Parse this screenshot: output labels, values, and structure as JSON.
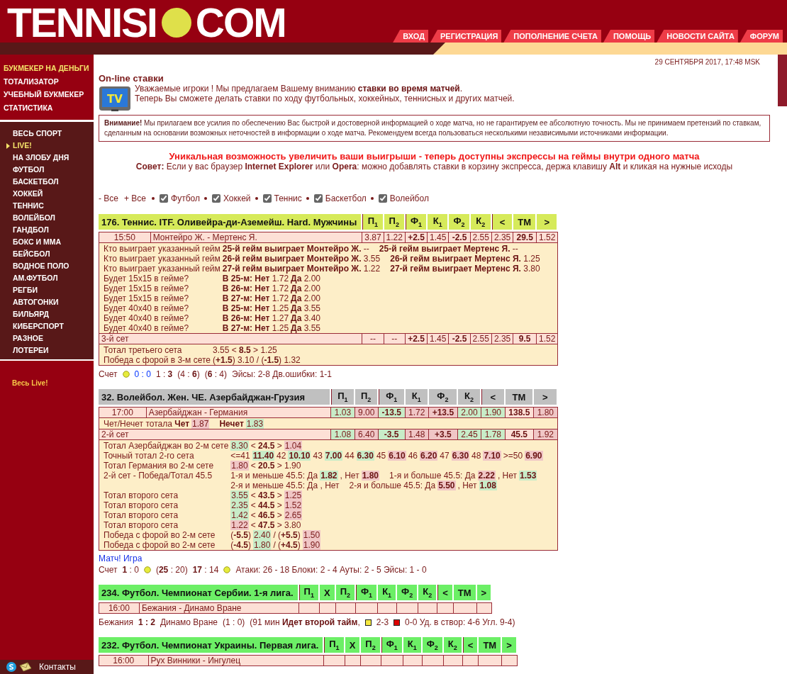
{
  "logo": {
    "left": "TENNISI",
    "right": "COM"
  },
  "nav": [
    {
      "label": "ВХОД"
    },
    {
      "label": "РЕГИСТРАЦИЯ"
    },
    {
      "label": "ПОПОЛНЕНИЕ СЧЕТА"
    },
    {
      "label": "ПОМОЩЬ"
    },
    {
      "label": "НОВОСТИ САЙТА"
    },
    {
      "label": "ФОРУМ"
    }
  ],
  "sidebar": {
    "main": [
      {
        "label": "БУКМЕКЕР НА ДЕНЬГИ",
        "selected": true
      },
      {
        "label": "ТОТАЛИЗАТОР",
        "selected": false
      },
      {
        "label": "УЧЕБНЫЙ БУКМЕКЕР",
        "selected": false
      },
      {
        "label": "СТАТИСТИКА",
        "selected": false
      }
    ],
    "sports": [
      {
        "label": "ВЕСЬ СПОРТ",
        "selected": false
      },
      {
        "label": "LIVE!",
        "selected": true
      },
      {
        "label": "НА ЗЛОБУ ДНЯ",
        "selected": false
      },
      {
        "label": "ФУТБОЛ",
        "selected": false
      },
      {
        "label": "БАСКЕТБОЛ",
        "selected": false
      },
      {
        "label": "ХОККЕЙ",
        "selected": false
      },
      {
        "label": "ТЕННИС",
        "selected": false
      },
      {
        "label": "ВОЛЕЙБОЛ",
        "selected": false
      },
      {
        "label": "ГАНДБОЛ",
        "selected": false
      },
      {
        "label": "БОКС И ММА",
        "selected": false
      },
      {
        "label": "БЕЙСБОЛ",
        "selected": false
      },
      {
        "label": "ВОДНОЕ ПОЛО",
        "selected": false
      },
      {
        "label": "АМ.ФУТБОЛ",
        "selected": false
      },
      {
        "label": "РЕГБИ",
        "selected": false
      },
      {
        "label": "АВТОГОНКИ",
        "selected": false
      },
      {
        "label": "БИЛЬЯРД",
        "selected": false
      },
      {
        "label": "КИБЕРСПОРТ",
        "selected": false
      },
      {
        "label": "РАЗНОЕ",
        "selected": false
      },
      {
        "label": "ЛОТЕРЕИ",
        "selected": false
      }
    ],
    "live_link": "Весь Live!",
    "contacts": "Контакты"
  },
  "date": "29 СЕНТЯБРЯ 2017, 17:48 MSK",
  "intro": {
    "title": "On-line ставки",
    "icon_label": "TV",
    "lines": [
      "Уважаемые игроки ! Мы предлагаем Вашему вниманию **ставки во время матчей**.",
      "Теперь Вы сможете делать ставки по ходу футбольных, хоккейных, теннисных и других матчей."
    ]
  },
  "notice": "**Внимание!** Мы прилагаем все усилия по обеспечению Вас быстрой и достоверной информацией о ходе матча, но не гарантируем ее абсолютную точность. Мы не принимаем претензий по ставкам, сделанным на основании возможных неточностей в информации о ходе матча. Рекомендуем всегда пользоваться несколькими независимыми источниками информации.",
  "promo": "Уникальная возможность увеличить ваши выигрыши - теперь доступны экспрессы на геймы внутри одного матча",
  "tip": "**Совет:** Если у вас браузер **Internet Explorer** или **Opera**: можно добавлять ставки в корзину экспресса, держа клавишу **Alt** и кликая на нужные исходы",
  "filters": {
    "minus_all": "- Все",
    "plus_all": "+ Все",
    "sports": [
      {
        "label": "Футбол",
        "checked": true
      },
      {
        "label": "Хоккей",
        "checked": true
      },
      {
        "label": "Теннис",
        "checked": true
      },
      {
        "label": "Баскетбол",
        "checked": true
      },
      {
        "label": "Волейбол",
        "checked": true
      }
    ]
  },
  "events": [
    {
      "title": "176. Теннис. ITF. Оливейра-ди-Аземейш. Hard. Мужчины",
      "color": "#d6ea5a",
      "column_groups": [
        [
          {
            "label": "П$_{1}$",
            "kind": "odds"
          },
          {
            "label": "П$_{2}$",
            "kind": "odds"
          }
        ],
        [
          {
            "label": "Ф$_{1}$",
            "kind": "line"
          },
          {
            "label": "К$_{1}$",
            "kind": "odds"
          },
          {
            "label": "Ф$_{2}$",
            "kind": "line"
          },
          {
            "label": "К$_{2}$",
            "kind": "odds"
          }
        ],
        [
          {
            "label": "<",
            "kind": "odds"
          },
          {
            "label": "ТМ",
            "kind": "line"
          },
          {
            "label": ">",
            "kind": "odds"
          }
        ]
      ],
      "blocks": [
        {
          "kind": "match",
          "time": "15:50",
          "teams": "Монтейро Ж. - Мертенс Я.",
          "cells": [
            {
              "text": "3.87"
            },
            {
              "text": "1.22"
            },
            {
              "text": "+2.5"
            },
            {
              "text": "1.45"
            },
            {
              "text": "-2.5"
            },
            {
              "text": "2.55"
            },
            {
              "text": "2.35"
            },
            {
              "text": "29.5"
            },
            {
              "text": "1.52"
            }
          ]
        },
        {
          "kind": "table",
          "rows": [
            {
              "label": "Кто выиграет указанный гейм",
              "groups": [
                [
                  {
                    "text": "**25-й гейм выиграет Монтейро Ж.** --"
                  }
                ],
                [
                  {
                    "text": "**25-й гейм выиграет Мертенс Я.** --"
                  }
                ]
              ]
            },
            {
              "label": "Кто выиграет указанный гейм",
              "groups": [
                [
                  {
                    "text": "**26-й гейм выиграет Монтейро Ж.** 3.55"
                  }
                ],
                [
                  {
                    "text": "**26-й гейм выиграет Мертенс Я.** 1.25"
                  }
                ]
              ]
            },
            {
              "label": "Кто выиграет указанный гейм",
              "groups": [
                [
                  {
                    "text": "**27-й гейм выиграет Монтейро Ж.** 1.22"
                  }
                ],
                [
                  {
                    "text": "**27-й гейм выиграет Мертенс Я.** 3.80"
                  }
                ]
              ]
            },
            {
              "label": "Будет 15x15 в гейме?",
              "groups": [
                [
                  {
                    "text": "**В 25-м: Нет** 1.72"
                  },
                  {
                    "text": "**Да** 2.00"
                  }
                ]
              ]
            },
            {
              "label": "Будет 15x15 в гейме?",
              "groups": [
                [
                  {
                    "text": "**В 26-м: Нет** 1.72"
                  },
                  {
                    "text": "**Да** 2.00"
                  }
                ]
              ]
            },
            {
              "label": "Будет 15x15 в гейме?",
              "groups": [
                [
                  {
                    "text": "**В 27-м: Нет** 1.72"
                  },
                  {
                    "text": "**Да** 2.00"
                  }
                ]
              ]
            },
            {
              "label": "Будет 40x40 в гейме?",
              "groups": [
                [
                  {
                    "text": "**В 25-м: Нет** 1.25"
                  },
                  {
                    "text": "**Да** 3.55"
                  }
                ]
              ]
            },
            {
              "label": "Будет 40x40 в гейме?",
              "groups": [
                [
                  {
                    "text": "**В 26-м: Нет** 1.27"
                  },
                  {
                    "text": "**Да** 3.40"
                  }
                ]
              ]
            },
            {
              "label": "Будет 40x40 в гейме?",
              "groups": [
                [
                  {
                    "text": "**В 27-м: Нет** 1.25"
                  },
                  {
                    "text": "**Да** 3.55"
                  }
                ]
              ]
            }
          ]
        },
        {
          "kind": "set",
          "label": "3-й сет",
          "cells": [
            {
              "text": "--"
            },
            {
              "text": "--"
            },
            {
              "text": "+2.5"
            },
            {
              "text": "1.45"
            },
            {
              "text": "-2.5"
            },
            {
              "text": "2.55"
            },
            {
              "text": "2.35"
            },
            {
              "text": "9.5"
            },
            {
              "text": "1.52"
            }
          ]
        },
        {
          "kind": "table",
          "rows": [
            {
              "label": "Тотал третьего сета",
              "groups": [
                [
                  {
                    "text": "3.55 < **8.5** > 1.25"
                  }
                ]
              ]
            },
            {
              "label": "Победа с форой в 3-м сете",
              "groups": [
                [
                  {
                    "text": "(**+1.5**) 3.10 / (**-1.5**) 1.32"
                  }
                ]
              ]
            }
          ]
        }
      ],
      "score": [
        {
          "kind": "text",
          "text": "Счет"
        },
        {
          "kind": "ball"
        },
        {
          "kind": "text",
          "text": "0 : 0",
          "color": "#0033ff"
        },
        {
          "kind": "text",
          "text": "1 : **3**"
        },
        {
          "kind": "text",
          "text": "(4 : **6**)"
        },
        {
          "kind": "text",
          "text": "(**6** : 4)"
        },
        {
          "kind": "text",
          "text": "Эйсы: 2-8 Дв.ошибки: 1-1"
        }
      ]
    },
    {
      "title": "32. Волейбол. Жен. ЧЕ. Азербайджан-Грузия",
      "color": "#c0c0c0",
      "column_groups": [
        [
          {
            "label": "П$_{1}$",
            "kind": "odds"
          },
          {
            "label": "П$_{2}$",
            "kind": "odds"
          }
        ],
        [
          {
            "label": "Ф$_{1}$",
            "kind": "line"
          },
          {
            "label": "К$_{1}$",
            "kind": "odds"
          },
          {
            "label": "Ф$_{2}$",
            "kind": "line"
          },
          {
            "label": "К$_{2}$",
            "kind": "odds"
          }
        ],
        [
          {
            "label": "<",
            "kind": "odds"
          },
          {
            "label": "ТМ",
            "kind": "line"
          },
          {
            "label": ">",
            "kind": "odds"
          }
        ]
      ],
      "blocks": [
        {
          "kind": "match",
          "time": "17:00",
          "teams": "Азербайджан - Германия",
          "cells": [
            {
              "text": "1.03",
              "color": "#c8ecc8"
            },
            {
              "text": "9.00",
              "color": "#f0c6c6"
            },
            {
              "text": "-13.5",
              "color": "#c8ecc8"
            },
            {
              "text": "1.72",
              "color": "#f0c6c6"
            },
            {
              "text": "+13.5",
              "color": "#f0c6c6"
            },
            {
              "text": "2.00",
              "color": "#c8ecc8"
            },
            {
              "text": "1.90",
              "color": "#c8ecc8"
            },
            {
              "text": "138.5"
            },
            {
              "text": "1.80",
              "color": "#f0c6c6"
            }
          ]
        },
        {
          "kind": "note",
          "groups": [
            [
              {
                "text": "Чет/Нечет тотала **Чет**"
              },
              {
                "text": "1.87",
                "color": "#f0c6c6"
              }
            ],
            [
              {
                "text": "**Нечет**"
              },
              {
                "text": "1.83",
                "color": "#c8ecc8"
              }
            ]
          ]
        },
        {
          "kind": "set",
          "label": "2-й сет",
          "cells": [
            {
              "text": "1.08",
              "color": "#c8ecc8"
            },
            {
              "text": "6.40",
              "color": "#f0c6c6"
            },
            {
              "text": "-3.5",
              "color": "#c8ecc8"
            },
            {
              "text": "1.48",
              "color": "#f0c6c6"
            },
            {
              "text": "+3.5",
              "color": "#f0c6c6"
            },
            {
              "text": "2.45",
              "color": "#c8ecc8"
            },
            {
              "text": "1.78",
              "color": "#c8ecc8"
            },
            {
              "text": "45.5"
            },
            {
              "text": "1.92",
              "color": "#f0c6c6"
            }
          ]
        },
        {
          "kind": "table",
          "rows": [
            {
              "label": "Тотал Азербайджан во 2-м сете",
              "groups": [
                [
                  {
                    "text": "8.30",
                    "color": "#c8ecc8"
                  },
                  {
                    "text": "< **24.5** >"
                  },
                  {
                    "text": "1.04",
                    "color": "#f0c6c6"
                  }
                ]
              ]
            },
            {
              "label": "Точный тотал 2-го сета",
              "groups": [
                [
                  {
                    "text": "<=41"
                  },
                  {
                    "text": "**11.40**",
                    "color": "#c8ecc8"
                  },
                  {
                    "text": "42"
                  },
                  {
                    "text": "**10.10**",
                    "color": "#c8ecc8"
                  },
                  {
                    "text": "43"
                  },
                  {
                    "text": "**7.00**",
                    "color": "#c8ecc8"
                  },
                  {
                    "text": "44"
                  },
                  {
                    "text": "**6.30**",
                    "color": "#c8ecc8"
                  },
                  {
                    "text": "45"
                  },
                  {
                    "text": "**6.10**",
                    "color": "#f0c6c6"
                  },
                  {
                    "text": "46"
                  },
                  {
                    "text": "**6.20**",
                    "color": "#f0c6c6"
                  },
                  {
                    "text": "47"
                  },
                  {
                    "text": "**6.30**",
                    "color": "#f0c6c6"
                  },
                  {
                    "text": "48"
                  },
                  {
                    "text": "**7.10**",
                    "color": "#f0c6c6"
                  },
                  {
                    "text": ">=50"
                  },
                  {
                    "text": "**6.90**",
                    "color": "#f0c6c6"
                  }
                ]
              ]
            },
            {
              "label": "Тотал Германия во 2-м сете",
              "groups": [
                [
                  {
                    "text": "1.80",
                    "color": "#f0c6c6"
                  },
                  {
                    "text": "< **20.5** > 1.90"
                  }
                ]
              ]
            },
            {
              "label": "2-й сет - Победа/Тотал 45.5",
              "groups": [
                [
                  {
                    "text": "1-я и меньше 45.5: Да"
                  },
                  {
                    "text": "**1.82**",
                    "color": "#c8ecc8"
                  },
                  {
                    "text": ", Нет"
                  },
                  {
                    "text": "**1.80**",
                    "color": "#f0c6c6"
                  }
                ],
                [
                  {
                    "text": "1-я и больше 45.5: Да"
                  },
                  {
                    "text": "**2.22**",
                    "color": "#f0c6c6"
                  },
                  {
                    "text": ", Нет"
                  },
                  {
                    "text": "**1.53**",
                    "color": "#c8ecc8"
                  }
                ]
              ]
            },
            {
              "groups": [
                [
                  {
                    "text": "2-я и меньше 45.5: Да , Нет"
                  }
                ],
                [
                  {
                    "text": "2-я и больше 45.5: Да"
                  },
                  {
                    "text": "**5.50**",
                    "color": "#f0c6c6"
                  },
                  {
                    "text": ", Нет"
                  },
                  {
                    "text": "**1.08**",
                    "color": "#c8ecc8"
                  }
                ]
              ]
            },
            {
              "label": "Тотал второго сета",
              "groups": [
                [
                  {
                    "text": "3.55",
                    "color": "#c8ecc8"
                  },
                  {
                    "text": "< **43.5** >"
                  },
                  {
                    "text": "1.25",
                    "color": "#f0c6c6"
                  }
                ]
              ]
            },
            {
              "label": "Тотал второго сета",
              "groups": [
                [
                  {
                    "text": "2.35",
                    "color": "#c8ecc8"
                  },
                  {
                    "text": "< **44.5** >"
                  },
                  {
                    "text": "1.52",
                    "color": "#f0c6c6"
                  }
                ]
              ]
            },
            {
              "label": "Тотал второго сета",
              "groups": [
                [
                  {
                    "text": "1.42",
                    "color": "#c8ecc8"
                  },
                  {
                    "text": "< **46.5** >"
                  },
                  {
                    "text": "2.65",
                    "color": "#f0c6c6"
                  }
                ]
              ]
            },
            {
              "label": "Тотал второго сета",
              "groups": [
                [
                  {
                    "text": "1.22",
                    "color": "#f0c6c6"
                  },
                  {
                    "text": "< **47.5** > 3.80"
                  }
                ]
              ]
            },
            {
              "label": "Победа с форой во 2-м сете",
              "groups": [
                [
                  {
                    "text": "(**-5.5**)"
                  },
                  {
                    "text": "2.40",
                    "color": "#c8ecc8"
                  },
                  {
                    "text": "/ (**+5.5**)"
                  },
                  {
                    "text": "1.50",
                    "color": "#f0c6c6"
                  }
                ]
              ]
            },
            {
              "label": "Победа с форой во 2-м сете",
              "groups": [
                [
                  {
                    "text": "(**-4.5**)"
                  },
                  {
                    "text": "1.80",
                    "color": "#c8ecc8"
                  },
                  {
                    "text": "/ (**+4.5**)"
                  },
                  {
                    "text": "1.90",
                    "color": "#f0c6c6"
                  }
                ]
              ]
            }
          ]
        }
      ],
      "link": "Матч! Игра",
      "score": [
        {
          "kind": "text",
          "text": "Счет"
        },
        {
          "kind": "text",
          "text": "**1** : 0"
        },
        {
          "kind": "ball"
        },
        {
          "kind": "text",
          "text": "(**25** : 20)"
        },
        {
          "kind": "text",
          "text": "**17** : 14"
        },
        {
          "kind": "ball"
        },
        {
          "kind": "text",
          "text": "Атаки: 26 - 18 Блоки: 2 - 4 Ауты: 2 - 5 Эйсы: 1 - 0"
        }
      ]
    },
    {
      "title": "234. Футбол. Чемпионат Сербии. 1-я лига.",
      "color": "#6cef66",
      "column_groups": [
        [
          {
            "label": "П$_{1}$",
            "kind": "odds"
          },
          {
            "label": "X",
            "kind": "odds"
          },
          {
            "label": "П$_{2}$",
            "kind": "odds"
          }
        ],
        [
          {
            "label": "Ф$_{1}$",
            "kind": "line"
          },
          {
            "label": "К$_{1}$",
            "kind": "odds"
          },
          {
            "label": "Ф$_{2}$",
            "kind": "line"
          },
          {
            "label": "К$_{2}$",
            "kind": "odds"
          }
        ],
        [
          {
            "label": "<",
            "kind": "odds"
          },
          {
            "label": "ТМ",
            "kind": "line"
          },
          {
            "label": ">",
            "kind": "odds"
          }
        ]
      ],
      "blocks": [
        {
          "kind": "match",
          "time": "16:00",
          "teams": "Бежания - Динамо Вране"
        }
      ],
      "score": [
        {
          "kind": "text",
          "text": "Бежания"
        },
        {
          "kind": "text",
          "text": "**1 : 2**"
        },
        {
          "kind": "text",
          "text": "Динамо Вране"
        },
        {
          "kind": "text",
          "text": "(1 : 0)"
        },
        {
          "kind": "text",
          "text": "(91 мин **Идет второй тайм**,"
        },
        {
          "kind": "card",
          "color": "#f5e940"
        },
        {
          "kind": "text",
          "text": "2-3"
        },
        {
          "kind": "card",
          "color": "#dd0000"
        },
        {
          "kind": "text",
          "text": "0-0 Уд. в створ: 4-6 Угл. 9-4)"
        }
      ]
    },
    {
      "title": "232. Футбол. Чемпионат Украины. Первая лига.",
      "color": "#6cef66",
      "column_groups": [
        [
          {
            "label": "П$_{1}$",
            "kind": "odds"
          },
          {
            "label": "X",
            "kind": "odds"
          },
          {
            "label": "П$_{2}$",
            "kind": "odds"
          }
        ],
        [
          {
            "label": "Ф$_{1}$",
            "kind": "line"
          },
          {
            "label": "К$_{1}$",
            "kind": "odds"
          },
          {
            "label": "Ф$_{2}$",
            "kind": "line"
          },
          {
            "label": "К$_{2}$",
            "kind": "odds"
          }
        ],
        [
          {
            "label": "<",
            "kind": "odds"
          },
          {
            "label": "ТМ",
            "kind": "line"
          },
          {
            "label": ">",
            "kind": "odds"
          }
        ]
      ],
      "blocks": [
        {
          "kind": "match",
          "time": "16:00",
          "teams": "Рух Винники - Ингулец"
        }
      ]
    }
  ]
}
